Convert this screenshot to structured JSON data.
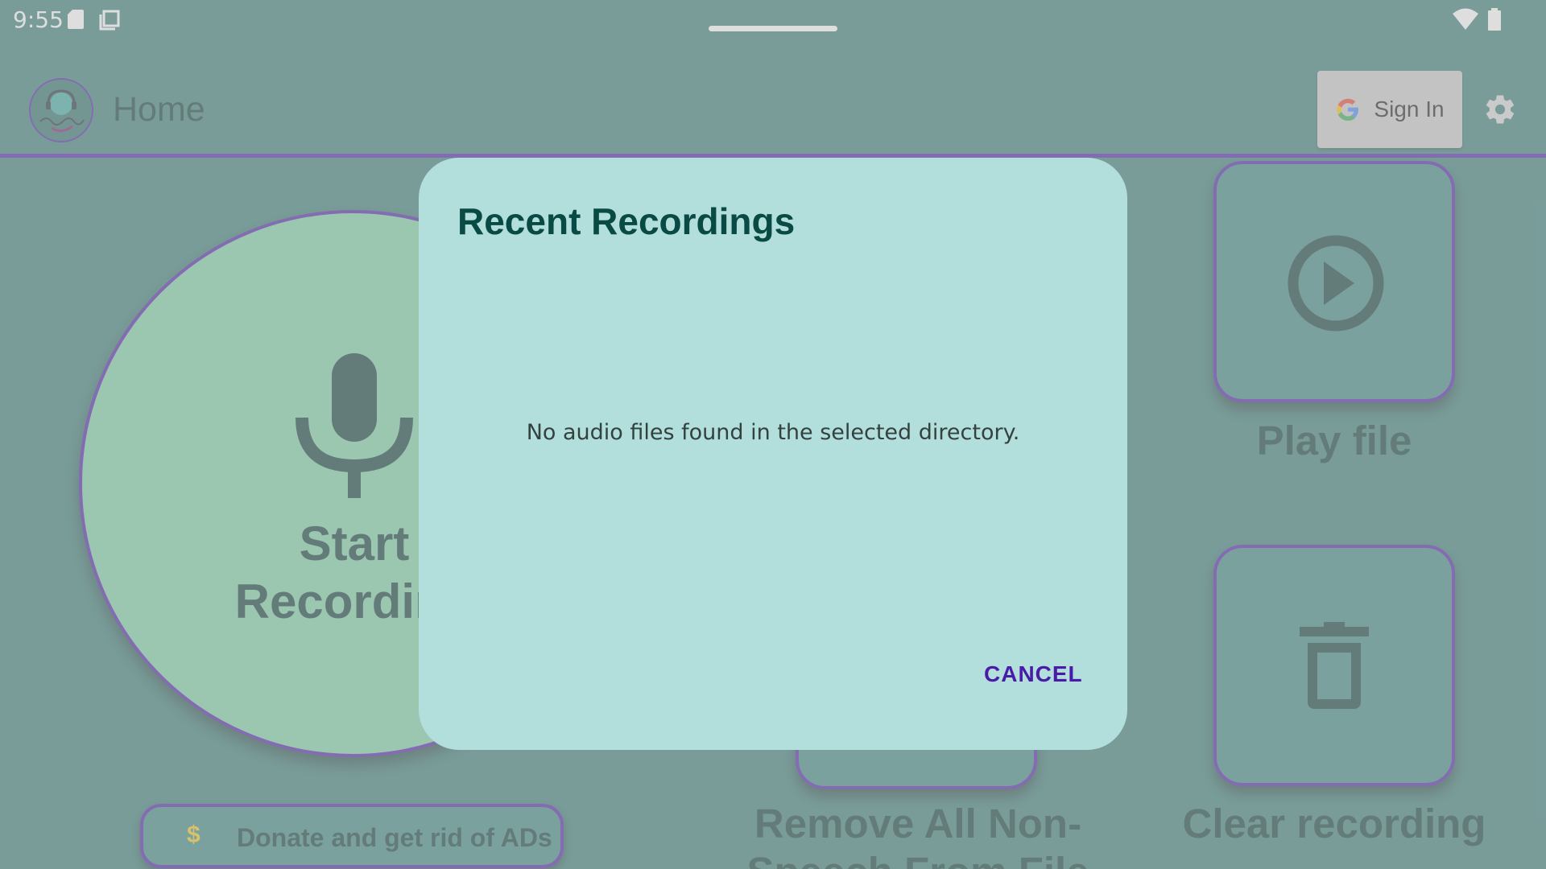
{
  "status_bar": {
    "time": "9:55",
    "icons": [
      "sd-card-icon",
      "copy-icon",
      "wifi-icon",
      "battery-icon"
    ]
  },
  "app_bar": {
    "title": "Home",
    "sign_in_label": "Sign In",
    "icons": [
      "avatar-logo",
      "google-icon",
      "gear-icon"
    ]
  },
  "main": {
    "record_button": {
      "label_line1": "Start",
      "label_line2": "Recording",
      "icon": "microphone-icon"
    },
    "play_button": {
      "label": "Play file",
      "icon": "play-circle-icon"
    },
    "remove_button": {
      "label_line1": "Remove All Non-",
      "label_line2": "Speech From File"
    },
    "clear_button": {
      "label": "Clear recording",
      "icon": "trash-icon"
    },
    "donate_button": {
      "label": "Donate and get rid of ADs",
      "icon": "dollar-icon"
    }
  },
  "dialog": {
    "title": "Recent Recordings",
    "message": "No audio files found in the selected directory.",
    "cancel_label": "CANCEL"
  },
  "colors": {
    "primary": "#347b75",
    "accent": "#4a1aa8",
    "record_button": "#78cfa2",
    "dialog_background": "#b2dfdb",
    "text_dark": "#0a3a35"
  }
}
